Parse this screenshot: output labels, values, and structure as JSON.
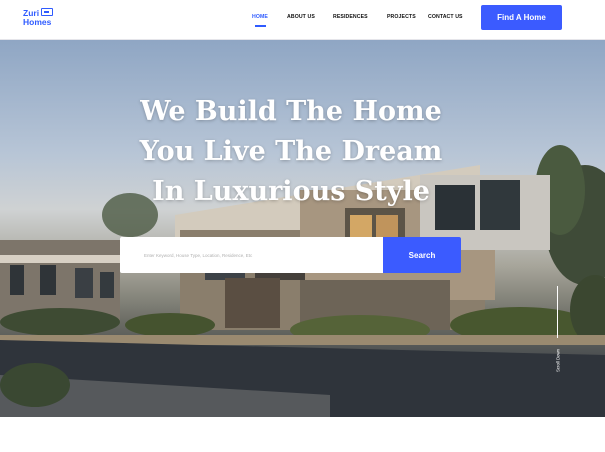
{
  "brand": {
    "line1": "Zuri",
    "line2": "Homes"
  },
  "nav": {
    "items": [
      {
        "label": "HOME",
        "active": true
      },
      {
        "label": "ABOUT US",
        "active": false
      },
      {
        "label": "RESIDENCES",
        "active": false
      },
      {
        "label": "PROJECTS",
        "active": false
      },
      {
        "label": "CONTACT US",
        "active": false
      }
    ],
    "cta_label": "Find A Home"
  },
  "hero": {
    "headline": [
      "We Build The Home",
      "You Live The Dream",
      "In Luxurious Style"
    ],
    "search": {
      "placeholder": "Enter Keyword, House Type, Location, Residence, Etc",
      "button_label": "Search"
    },
    "scroll_label": "Scroll Down"
  },
  "colors": {
    "accent": "#3b5bff",
    "text": "#111111",
    "white": "#ffffff"
  },
  "icons": [
    "logo-house-icon"
  ]
}
